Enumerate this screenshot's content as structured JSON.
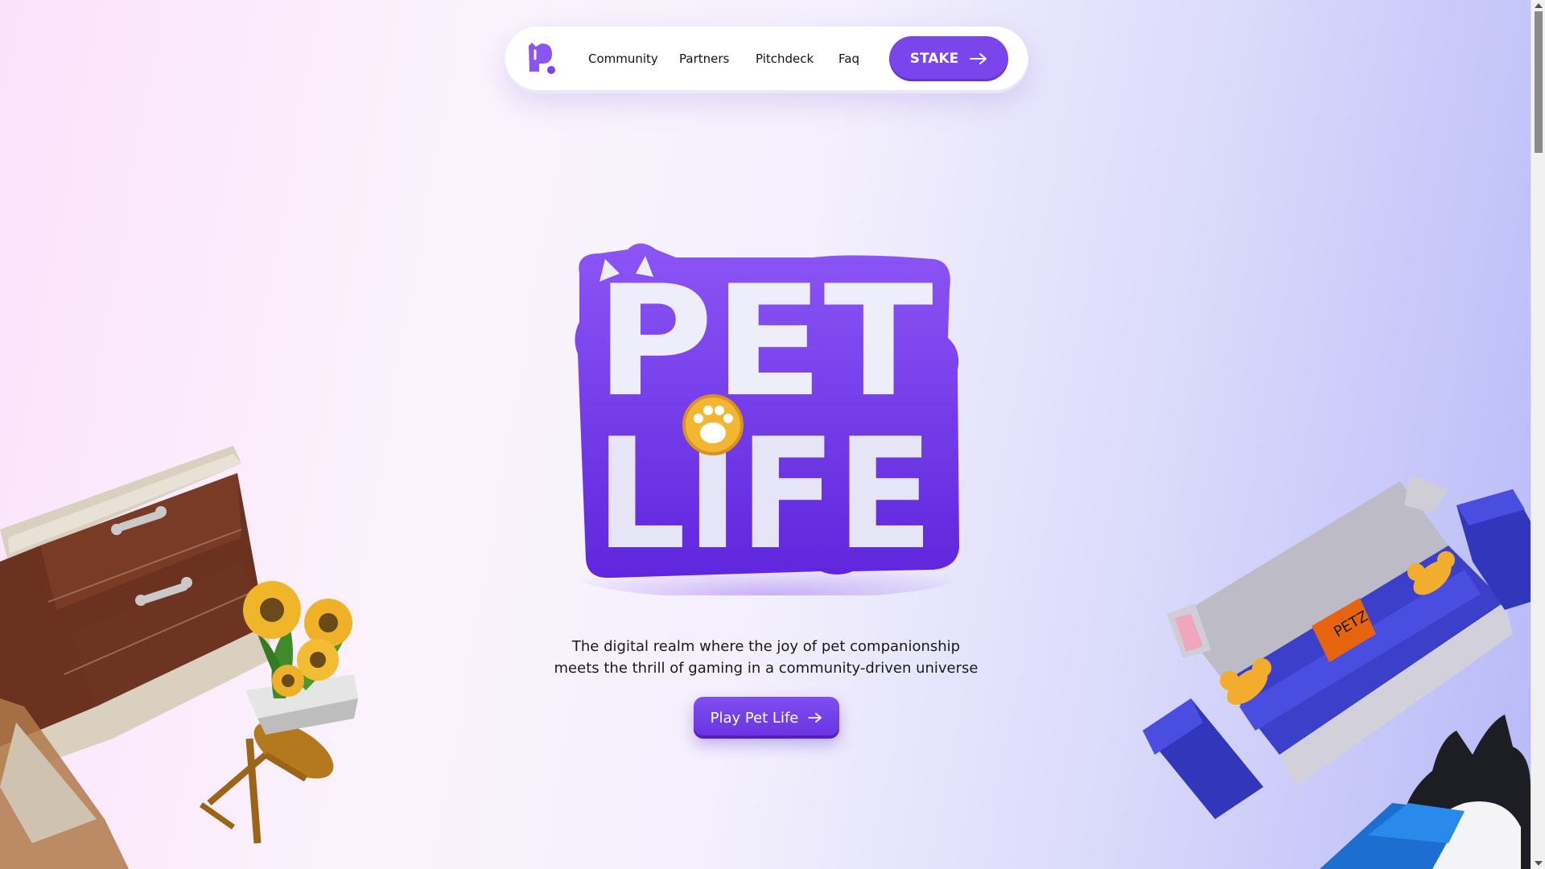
{
  "nav": {
    "logo_icon": "pet-life-p-logo-icon",
    "links": [
      "Community",
      "Partners",
      "Pitchdeck",
      "Faq"
    ],
    "stake_label": "STAKE",
    "stake_icon": "arrow-right-icon"
  },
  "hero": {
    "logo_text_top": "PET",
    "logo_text_bottom": "LIFE",
    "logo_badge_icon": "paw-icon",
    "tagline_line1": "The digital realm where the joy of pet companionship",
    "tagline_line2": "meets the thrill of gaming in a community-driven universe",
    "play_label": "Play Pet Life",
    "play_icon": "arrow-right-icon"
  },
  "decor": {
    "sofa_tag": "PETZ"
  },
  "colors": {
    "accent": "#7b45ec",
    "logo_purple": "#6e34e6",
    "logo_letters": "#eeedfa",
    "paw_badge": "#f2b632"
  }
}
